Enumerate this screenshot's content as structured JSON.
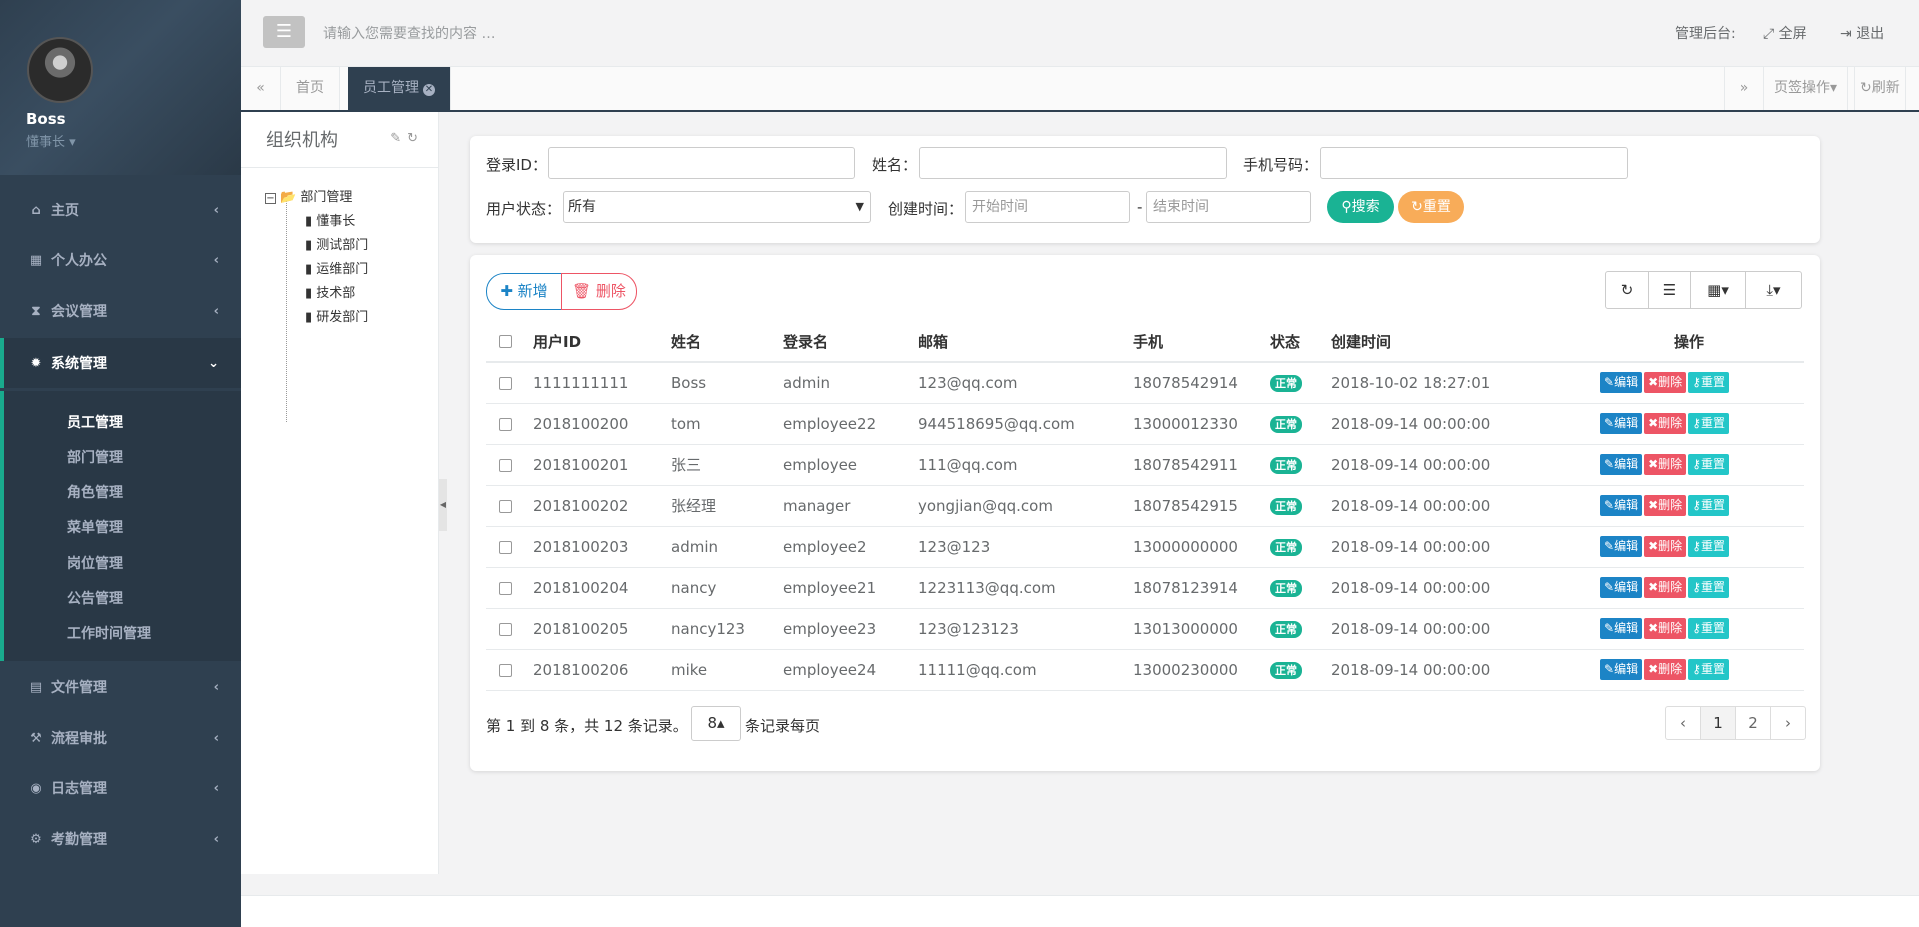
{
  "sidebar": {
    "user_name": "Boss",
    "user_role": "懂事长 ▾",
    "items": [
      {
        "label": "主页",
        "icon": "home-icon"
      },
      {
        "label": "个人办公",
        "icon": "calendar-icon"
      },
      {
        "label": "会议管理",
        "icon": "hourglass-icon"
      },
      {
        "label": "系统管理",
        "icon": "gear-icon"
      },
      {
        "label": "文件管理",
        "icon": "file-icon"
      },
      {
        "label": "流程审批",
        "icon": "gavel-icon"
      },
      {
        "label": "日志管理",
        "icon": "eye-icon"
      },
      {
        "label": "考勤管理",
        "icon": "gears-icon"
      }
    ],
    "submenu": [
      "员工管理",
      "部门管理",
      "角色管理",
      "菜单管理",
      "岗位管理",
      "公告管理",
      "工作时间管理"
    ]
  },
  "topbar": {
    "search_placeholder": "请输入您需要查找的内容 …",
    "admin_label": "管理后台:",
    "fullscreen_label": "全屏",
    "logout_label": "退出"
  },
  "tabs": {
    "home": "首页",
    "current": "员工管理",
    "tab_ops": "页签操作▾",
    "refresh": "刷新"
  },
  "org": {
    "title": "组织机构",
    "root": "部门管理",
    "children": [
      "懂事长",
      "测试部门",
      "运维部门",
      "技术部",
      "研发部门"
    ]
  },
  "search_form": {
    "login_id_label": "登录ID：",
    "name_label": "姓名：",
    "phone_label": "手机号码：",
    "status_label": "用户状态：",
    "status_value": "所有",
    "created_label": "创建时间：",
    "start_placeholder": "开始时间",
    "end_placeholder": "结束时间",
    "dash": "-",
    "search_btn": "搜索",
    "reset_btn": "重置"
  },
  "toolbar": {
    "add_label": "新增",
    "delete_label": "删除"
  },
  "table": {
    "columns": [
      "用户ID",
      "姓名",
      "登录名",
      "邮箱",
      "手机",
      "状态",
      "创建时间",
      "操作"
    ],
    "actions": {
      "edit": "编辑",
      "delete": "删除",
      "reset": "重置"
    },
    "rows": [
      {
        "id": "1111111111",
        "name": "Boss",
        "login": "admin",
        "email": "123@qq.com",
        "phone": "18078542914",
        "status": "正常",
        "created": "2018-10-02 18:27:01"
      },
      {
        "id": "2018100200",
        "name": "tom",
        "login": "employee22",
        "email": "944518695@qq.com",
        "phone": "13000012330",
        "status": "正常",
        "created": "2018-09-14 00:00:00"
      },
      {
        "id": "2018100201",
        "name": "张三",
        "login": "employee",
        "email": "111@qq.com",
        "phone": "18078542911",
        "status": "正常",
        "created": "2018-09-14 00:00:00"
      },
      {
        "id": "2018100202",
        "name": "张经理",
        "login": "manager",
        "email": "yongjian@qq.com",
        "phone": "18078542915",
        "status": "正常",
        "created": "2018-09-14 00:00:00"
      },
      {
        "id": "2018100203",
        "name": "admin",
        "login": "employee2",
        "email": "123@123",
        "phone": "13000000000",
        "status": "正常",
        "created": "2018-09-14 00:00:00"
      },
      {
        "id": "2018100204",
        "name": "nancy",
        "login": "employee21",
        "email": "1223113@qq.com",
        "phone": "18078123914",
        "status": "正常",
        "created": "2018-09-14 00:00:00"
      },
      {
        "id": "2018100205",
        "name": "nancy123",
        "login": "employee23",
        "email": "123@123123",
        "phone": "13013000000",
        "status": "正常",
        "created": "2018-09-14 00:00:00"
      },
      {
        "id": "2018100206",
        "name": "mike",
        "login": "employee24",
        "email": "11111@qq.com",
        "phone": "13000230000",
        "status": "正常",
        "created": "2018-09-14 00:00:00"
      }
    ]
  },
  "pagination": {
    "summary": "第 1 到 8 条，共 12 条记录。",
    "page_size": "8",
    "per_page_suffix": "条记录每页",
    "prev": "‹",
    "next": "›",
    "pages": [
      "1",
      "2"
    ]
  },
  "colors": {
    "sidebar_bg": "#2f4050",
    "accent_green": "#1ab394",
    "warning_orange": "#f8ac59",
    "edit_blue": "#1c84c6",
    "danger_red": "#ed5565",
    "info_teal": "#23c6c8"
  }
}
